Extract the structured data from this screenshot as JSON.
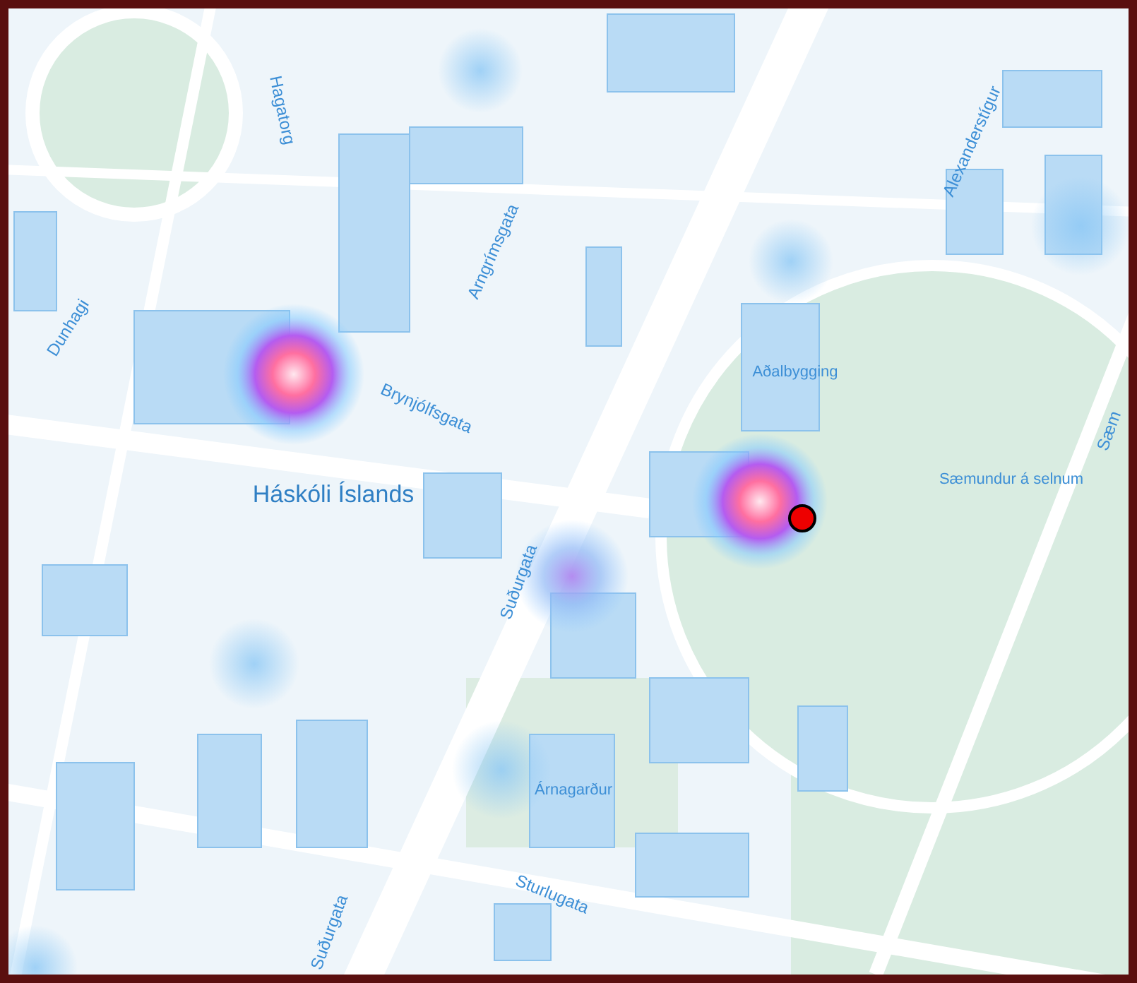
{
  "map": {
    "labels": [
      {
        "kind": "street",
        "text": "Hagatorg"
      },
      {
        "kind": "street",
        "text": "Dunhagi"
      },
      {
        "kind": "street",
        "text": "Arngrímsgata"
      },
      {
        "kind": "street",
        "text": "Alexanderstígur"
      },
      {
        "kind": "street",
        "text": "Brynjólfsgata"
      },
      {
        "kind": "district",
        "text": "Háskóli Íslands"
      },
      {
        "kind": "place",
        "text": "Aðalbygging"
      },
      {
        "kind": "place",
        "text": "Sæmundur á selnum"
      },
      {
        "kind": "street",
        "text": "Sæm"
      },
      {
        "kind": "street",
        "text": "Suðurgata"
      },
      {
        "kind": "place",
        "text": "Árnagarður"
      },
      {
        "kind": "street",
        "text": "Sturlugata"
      },
      {
        "kind": "street",
        "text": "Suðurgata"
      }
    ]
  }
}
